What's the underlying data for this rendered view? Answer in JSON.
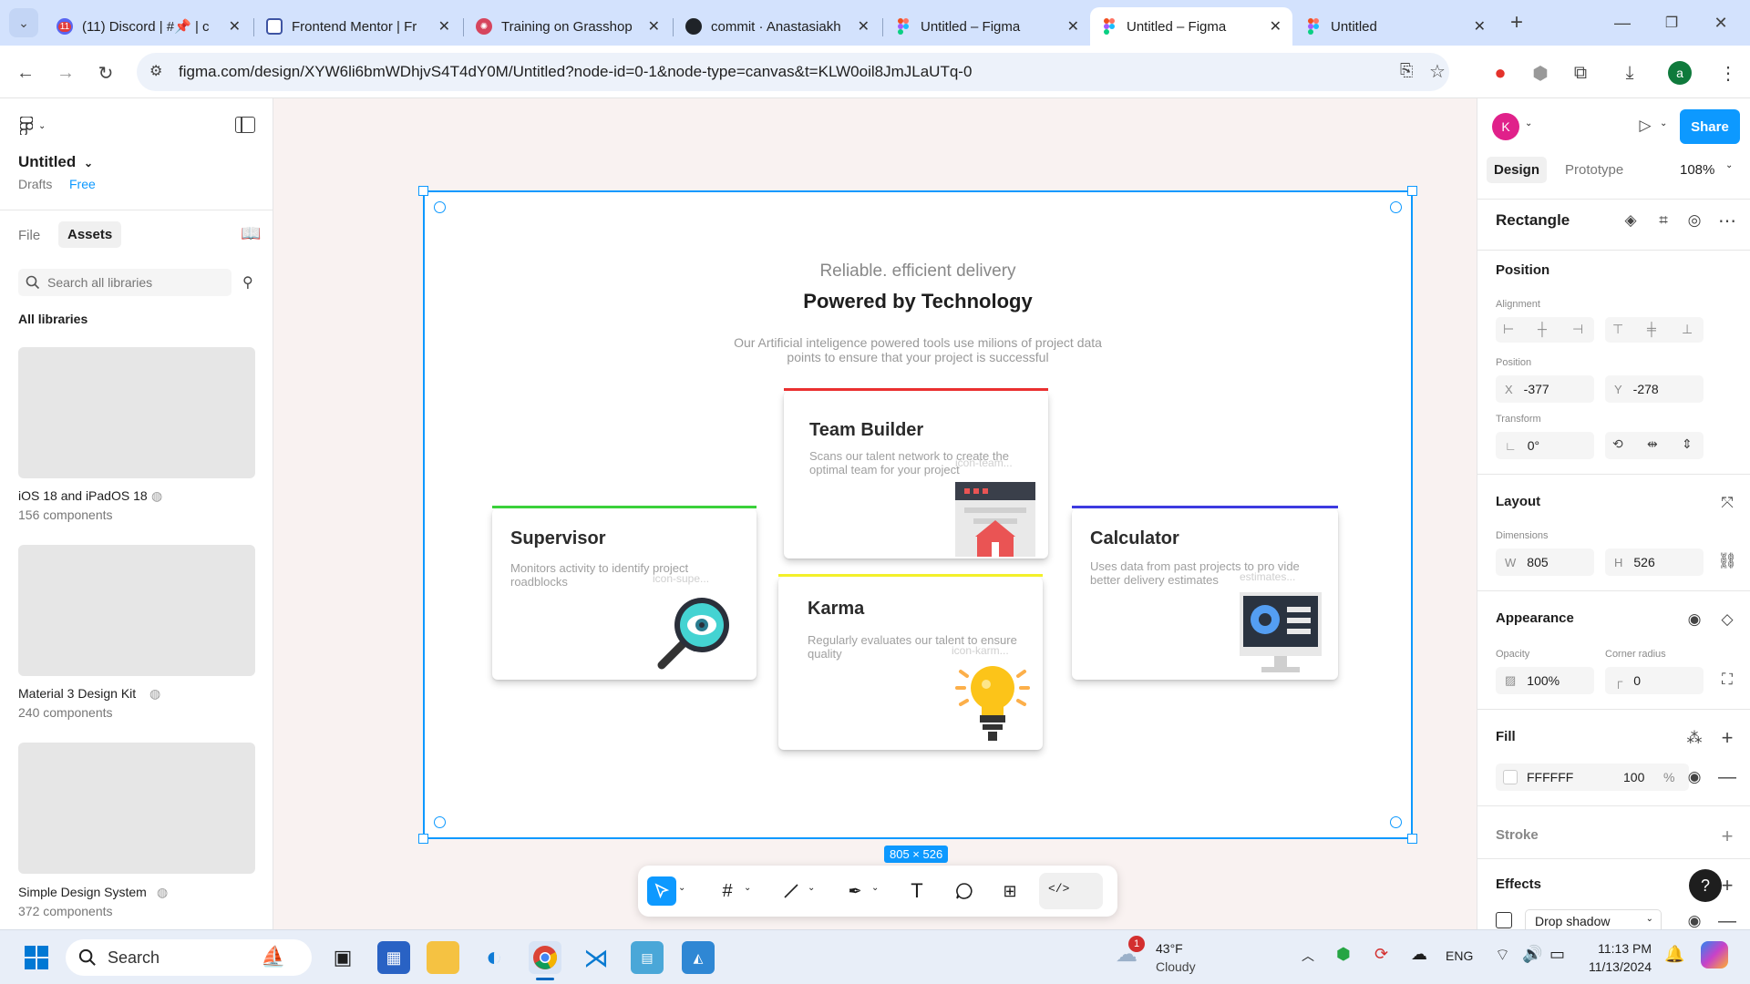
{
  "browser": {
    "tabs": [
      {
        "title": "(11) Discord | #📌 | c",
        "badge": "11",
        "favicon_color": "#5865f2"
      },
      {
        "title": "Frontend Mentor | Fr",
        "favicon_color": "#3e54a3"
      },
      {
        "title": "Training on Grasshop",
        "favicon_color": "#d6455d"
      },
      {
        "title": "commit · Anastasiakh",
        "favicon_color": "#1f2328"
      },
      {
        "title": "Untitled – Figma",
        "favicon_color": "#f24e1e"
      },
      {
        "title": "Untitled – Figma",
        "favicon_color": "#f24e1e",
        "active": true
      },
      {
        "title": "Untitled",
        "favicon_color": "#f24e1e"
      }
    ],
    "url": "figma.com/design/XYW6li6bmWDhjvS4T4dY0M/Untitled?node-id=0-1&node-type=canvas&t=KLW0oil8JmJLaUTq-0",
    "profile_initial": "a"
  },
  "figma": {
    "file": {
      "name": "Untitled",
      "location": "Drafts",
      "plan": "Free"
    },
    "left_tabs": [
      "File",
      "Assets"
    ],
    "search_placeholder": "Search all libraries",
    "all_libraries": "All libraries",
    "libraries": [
      {
        "name": "iOS 18 and iPadOS 18",
        "count": "156 components"
      },
      {
        "name": "Material 3 Design Kit",
        "count": "240 components"
      },
      {
        "name": "Simple Design System",
        "count": "372 components"
      }
    ],
    "header": {
      "avatar": "K",
      "share": "Share",
      "tabs": [
        "Design",
        "Prototype"
      ],
      "zoom": "108%"
    },
    "props": {
      "selection": "Rectangle",
      "position_title": "Position",
      "alignment_label": "Alignment",
      "position_label": "Position",
      "x_label": "X",
      "x": "-377",
      "y_label": "Y",
      "y": "-278",
      "transform_label": "Transform",
      "rotation": "0°",
      "layout_title": "Layout",
      "dimensions_label": "Dimensions",
      "w_label": "W",
      "w": "805",
      "h_label": "H",
      "h": "526",
      "appearance_title": "Appearance",
      "opacity_label": "Opacity",
      "opacity": "100%",
      "radius_label": "Corner radius",
      "radius": "0",
      "fill_title": "Fill",
      "fill_hex": "FFFFFF",
      "fill_opacity": "100",
      "fill_pct": "%",
      "stroke_title": "Stroke",
      "effects_title": "Effects",
      "effect_type": "Drop shadow"
    },
    "size_label": "805 × 526"
  },
  "design": {
    "subtitle": "Reliable. efficient delivery",
    "title": "Powered by Technology",
    "desc_line1": "Our Artificial inteligence powered tools use milions of project data",
    "desc_line2": "points to ensure that your project is successful",
    "cards": {
      "team": {
        "title": "Team Builder",
        "desc": "Scans our talent network to create the optimal team for your project",
        "icon_label": "icon-team...",
        "accent": "#ea5454"
      },
      "supervisor": {
        "title": "Supervisor",
        "desc": "Monitors activity to identify project roadblocks",
        "icon_label": "icon-supe...",
        "accent": "#44d3d2"
      },
      "karma": {
        "title": "Karma",
        "desc": "Regularly evaluates our talent to ensure quality",
        "icon_label": "icon-karm...",
        "accent": "#fcaf4a"
      },
      "calculator": {
        "title": "Calculator",
        "desc": "Uses data from past projects to pro vide better delivery estimates",
        "icon_label": "estimates...",
        "accent": "#549ef2"
      }
    }
  },
  "taskbar": {
    "search": "Search",
    "weather_badge": "1",
    "temp": "43°F",
    "condition": "Cloudy",
    "lang": "ENG",
    "time": "11:13 PM",
    "date": "11/13/2024"
  }
}
